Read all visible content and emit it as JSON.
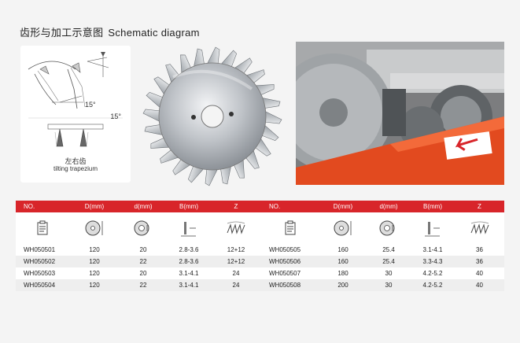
{
  "header": {
    "title_cn": "齿形与加工示意图",
    "title_en": "Schematic diagram"
  },
  "schematic": {
    "angle_top": "15°",
    "angle_mid": "15°",
    "caption_cn": "左右齿",
    "caption_en": "tilting trapezium"
  },
  "table": {
    "headers": [
      "NO.",
      "D(mm)",
      "d(mm)",
      "B(mm)",
      "Z",
      "NO.",
      "D(mm)",
      "d(mm)",
      "B(mm)",
      "Z"
    ],
    "rows": [
      [
        "WH050501",
        "120",
        "20",
        "2.8-3.6",
        "12+12",
        "WH050505",
        "160",
        "25.4",
        "3.1-4.1",
        "36"
      ],
      [
        "WH050502",
        "120",
        "22",
        "2.8-3.6",
        "12+12",
        "WH050506",
        "160",
        "25.4",
        "3.3-4.3",
        "36"
      ],
      [
        "WH050503",
        "120",
        "20",
        "3.1-4.1",
        "24",
        "WH050507",
        "180",
        "30",
        "4.2-5.2",
        "40"
      ],
      [
        "WH050504",
        "120",
        "22",
        "3.1-4.1",
        "24",
        "WH050508",
        "200",
        "30",
        "4.2-5.2",
        "40"
      ]
    ]
  },
  "colors": {
    "accent": "#d8252a",
    "row_alt": "#eeeeee",
    "background": "#f4f4f4"
  },
  "icons": [
    "document-icon",
    "outer-diameter-icon",
    "bore-diameter-icon",
    "kerf-width-icon",
    "teeth-count-icon"
  ]
}
